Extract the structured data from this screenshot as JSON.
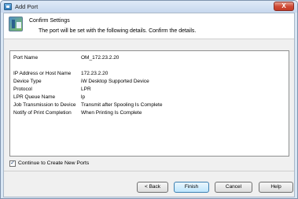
{
  "window": {
    "title": "Add Port",
    "close_label": "X"
  },
  "header": {
    "title": "Confirm Settings",
    "description": "The port will be set with the following details. Confirm the details."
  },
  "details": [
    {
      "label": "Port Name",
      "value": "OM_172.23.2.20"
    },
    {
      "label": "IP Address or Host Name",
      "value": "172.23.2.20"
    },
    {
      "label": "Device Type",
      "value": "iW Desktop Supported Device"
    },
    {
      "label": "Protocol",
      "value": "LPR"
    },
    {
      "label": "LPR Queue Name",
      "value": "lp"
    },
    {
      "label": "Job Transmission to Device",
      "value": "Transmit after Spooling Is Complete"
    },
    {
      "label": "Notify of Print Completion",
      "value": "When Printing Is Complete"
    }
  ],
  "options": {
    "continue_label": "Continue to Create New Ports",
    "continue_checked": true,
    "check_glyph": "✓"
  },
  "buttons": {
    "back": "< Back",
    "finish": "Finish",
    "cancel": "Cancel",
    "help": "Help"
  }
}
